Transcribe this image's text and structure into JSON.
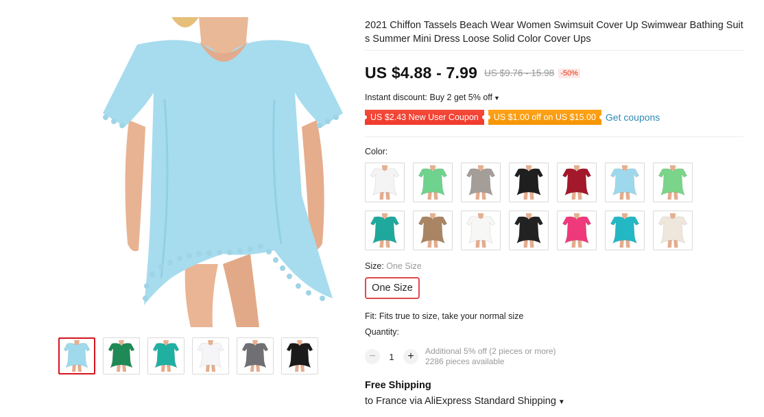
{
  "product": {
    "title": "2021 Chiffon Tassels Beach Wear Women Swimsuit Cover Up Swimwear Bathing Suits Summer Mini Dress Loose Solid Color Cover Ups",
    "price": "US $4.88 - 7.99",
    "original_price": "US $9.76 - 15.98",
    "discount": "-50%",
    "instant_discount": "Instant discount: Buy 2 get 5% off"
  },
  "coupons": {
    "new_user": "US $2.43 New User Coupon",
    "off": "US $1.00 off on US $15.00",
    "get": "Get coupons"
  },
  "color": {
    "label": "Color:",
    "swatches": [
      {
        "icon": "white-dress-thumb",
        "color": "#f4f4f4"
      },
      {
        "icon": "green-dress-thumb",
        "color": "#6fd38e"
      },
      {
        "icon": "gray-dress-thumb",
        "color": "#a49d98"
      },
      {
        "icon": "black-dress-thumb",
        "color": "#1f1f1f"
      },
      {
        "icon": "red-dress-thumb",
        "color": "#a3182a"
      },
      {
        "icon": "light-blue-dress-thumb",
        "color": "#9ed8ec"
      },
      {
        "icon": "mint-green-dress-thumb",
        "color": "#7ad489"
      },
      {
        "icon": "teal-dress-thumb",
        "color": "#1fa99c"
      },
      {
        "icon": "khaki-dress-thumb",
        "color": "#a98563"
      },
      {
        "icon": "white-photo-thumb",
        "color": "#f7f7f5"
      },
      {
        "icon": "black-photo-thumb",
        "color": "#222222"
      },
      {
        "icon": "rose-photo-thumb",
        "color": "#ee3a7a"
      },
      {
        "icon": "turquoise-photo-thumb",
        "color": "#23b8c4"
      },
      {
        "icon": "beige-photo-thumb",
        "color": "#efe6dc"
      }
    ]
  },
  "size": {
    "label": "Size:",
    "selected": "One Size",
    "option": "One Size"
  },
  "fit": "Fit: Fits true to size, take your normal size",
  "quantity": {
    "label": "Quantity:",
    "value": "1",
    "minus": "−",
    "plus": "+",
    "note": "Additional 5% off (2 pieces or more)",
    "available": "2286 pieces available"
  },
  "shipping": {
    "title": "Free Shipping",
    "desc": "to France via AliExpress Standard Shipping"
  },
  "gallery": {
    "thumbs": [
      {
        "icon": "light-blue-dress-thumb",
        "color": "#9fd9ec",
        "active": true
      },
      {
        "icon": "green-dress-thumb",
        "color": "#1f8a55",
        "active": false
      },
      {
        "icon": "teal-dress-thumb",
        "color": "#1fb0a2",
        "active": false
      },
      {
        "icon": "white-dress-thumb",
        "color": "#f5f5f8",
        "active": false
      },
      {
        "icon": "gray-dress-thumb",
        "color": "#6f6f74",
        "active": false
      },
      {
        "icon": "black-dress-thumb",
        "color": "#1a1a1a",
        "active": false
      }
    ]
  },
  "colors": {
    "price": "#111111",
    "coupon_red": "#f03a2c",
    "coupon_orange": "#f59400",
    "link": "#2e8ab5",
    "selected_border": "#d4141d"
  }
}
